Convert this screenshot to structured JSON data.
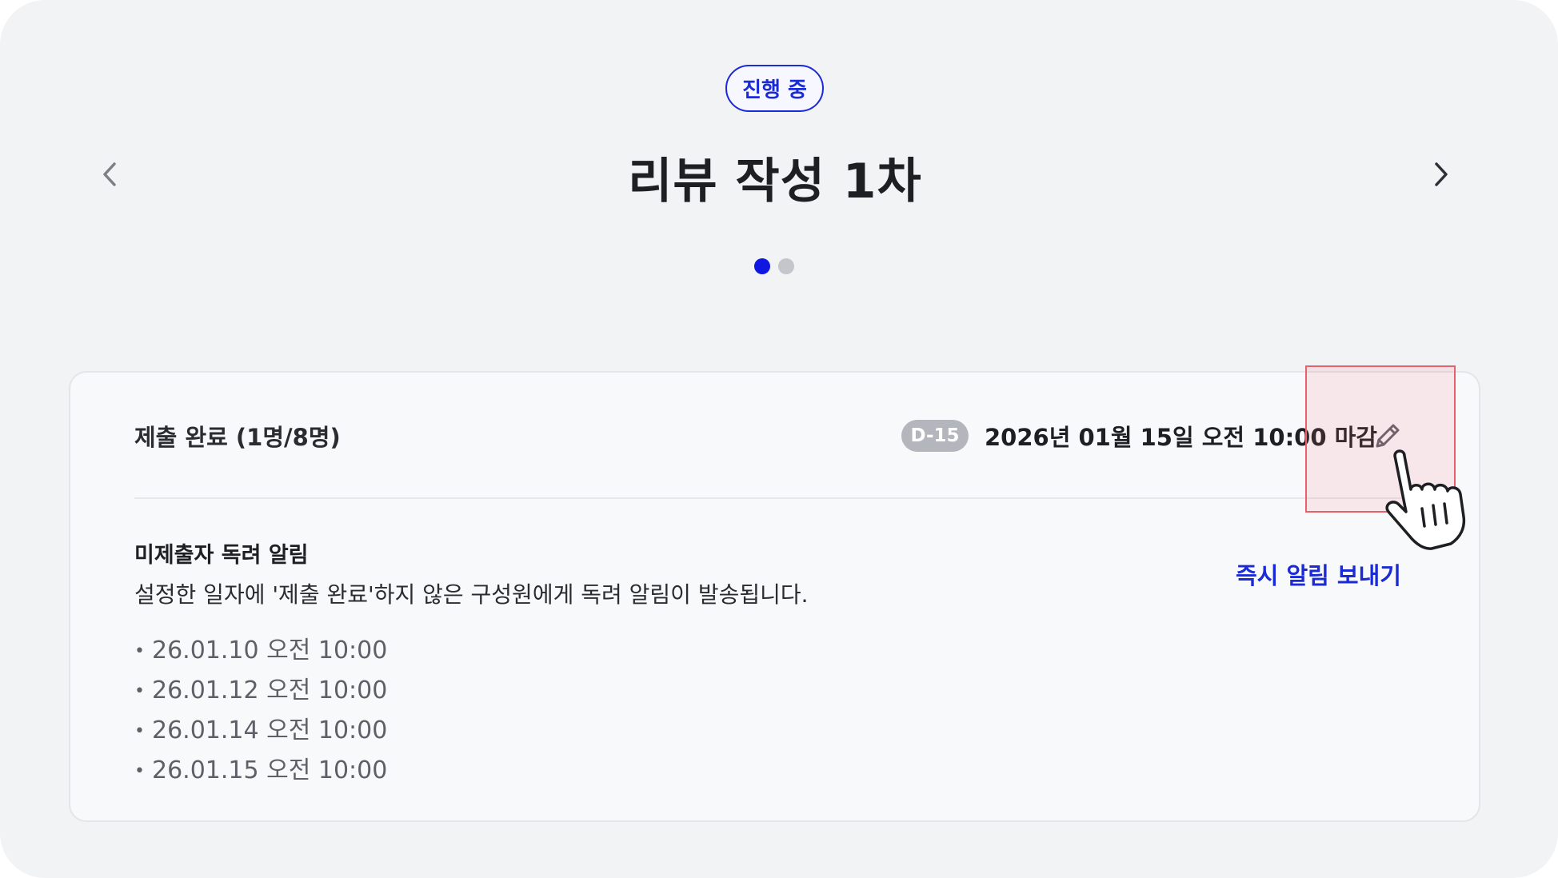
{
  "header": {
    "status_label": "진행 중",
    "title": "리뷰 작성 1차",
    "pager": {
      "total": 2,
      "active": 1
    }
  },
  "card": {
    "submit_status": "제출 완료 (1명/8명)",
    "dday_badge": "D-15",
    "deadline": "2026년 01월 15일 오전 10:00 마감",
    "reminder": {
      "title": "미제출자 독려 알림",
      "description": "설정한 일자에 '제출 완료'하지 않은 구성원에게 독려 알림이 발송됩니다.",
      "schedule": [
        "26.01.10 오전 10:00",
        "26.01.12 오전 10:00",
        "26.01.14 오전 10:00",
        "26.01.15 오전 10:00"
      ],
      "send_now_label": "즉시 알림 보내기"
    }
  },
  "icons": {
    "prev": "chevron-left-icon",
    "next": "chevron-right-icon",
    "edit": "pencil-icon",
    "cursor": "hand-pointer-cursor"
  },
  "colors": {
    "accent": "#1a2ad6",
    "badge_gray": "#b3b6bc",
    "background": "#f2f3f5",
    "highlight": "#e8606a"
  }
}
